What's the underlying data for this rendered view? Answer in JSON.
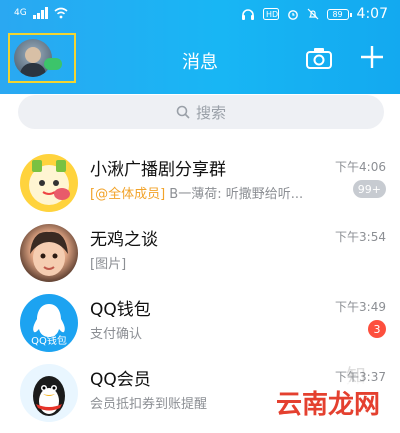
{
  "status_bar": {
    "signal": "4G",
    "time": "4:07",
    "battery": "89"
  },
  "header": {
    "title": "消息"
  },
  "search": {
    "placeholder": "搜索"
  },
  "chats": [
    {
      "name": "小湫广播剧分享群",
      "mention": "[@全体成员]",
      "preview": " B一薄荷: 听撒野给听...",
      "time": "下午4:06",
      "badge": "99+",
      "badge_style": "grey",
      "avatar": "group-avatar"
    },
    {
      "name": "无鸡之谈",
      "mention": "",
      "preview": "[图片]",
      "time": "下午3:54",
      "badge": "",
      "badge_style": "",
      "avatar": "girl-avatar"
    },
    {
      "name": "QQ钱包",
      "mention": "",
      "preview": "支付确认",
      "time": "下午3:49",
      "badge": "3",
      "badge_style": "red",
      "avatar": "qq-wallet-avatar",
      "avatar_text": "QQ钱包"
    },
    {
      "name": "QQ会员",
      "mention": "",
      "preview": "会员抵扣券到账提醒",
      "time": "下午3:37",
      "badge": "",
      "badge_style": "",
      "avatar": "qq-vip-avatar"
    }
  ],
  "watermark": {
    "text": "云南龙网",
    "ghost": "知"
  }
}
